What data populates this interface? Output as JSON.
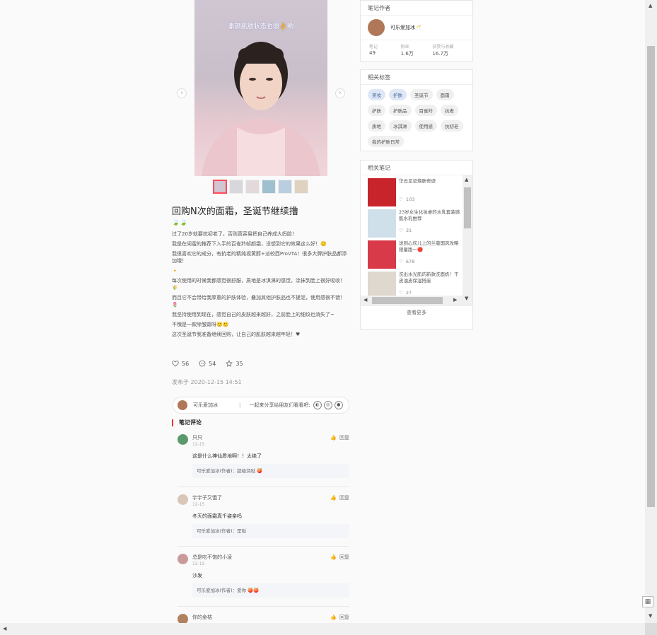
{
  "carousel": {
    "caption": "素颜肌肤状态也很👌哟",
    "prev": "‹",
    "next": "›",
    "thumb_count": 6
  },
  "post": {
    "title": "回购N次的面霜，圣诞节继续撸",
    "emoji_line": "🍃🍃",
    "paragraphs": [
      "过了20岁就要抗初老了，否则真容易把自己养成大妈脸！",
      "我是在闺蜜的推荐下入手的百雀羚帧颜霜，没想到它的效果这么好！🙂",
      "我很喜欢它的成分，有抗老的精纯视黄醇+派较西ProVTA！很多大牌护肤品都添加哦！",
      "🔸",
      "每次使用的时候我都感觉很舒服，质地是冰淇淋的感觉，涂抹到脸上很好吸收！🌾",
      "而且它不会带给我厚重的护肤体验，叠加其他护肤品也不搓泥，使用感很不错！🌷",
      "我坚持使用到现在，感觉自己的皮肤越来越好，之前脸上的细纹也消失了~",
      "不愧是一款除皱霜呀🙂🙂",
      "这次圣诞节我准备继续回购，让自己的肌肤越来越年轻！♥"
    ],
    "likes": "56",
    "comments_count": "54",
    "collects": "35",
    "published": "发布于 2020-12-15 14:51"
  },
  "share": {
    "author": "可乐爱加冰",
    "prompt": "一起来分享给朋友们看看吧:",
    "icons": [
      "wechat-icon",
      "moments-icon",
      "weibo-icon"
    ]
  },
  "comments": {
    "heading": "笔记评论",
    "reply_label": "回复",
    "items": [
      {
        "name": "只只",
        "date": "12-15",
        "text": "这是什么神仙质地啊！！太绝了",
        "reply": "可乐爱加冰(作者)：超级润哒 🍑"
      },
      {
        "name": "宇宇子又饿了",
        "date": "12-15",
        "text": "冬天的面霜真千姿亲吗",
        "reply": "可乐爱加冰(作者)：是哒"
      },
      {
        "name": "总是吃不饱的小凌",
        "date": "12-15",
        "text": "沙发",
        "reply": "可乐爱加冰(作者)：爱你 🍑🍑"
      },
      {
        "name": "你的金桔",
        "date": "",
        "text": "",
        "reply": ""
      }
    ]
  },
  "author_card": {
    "heading": "笔记作者",
    "name": "可乐爱加冰🥂",
    "stats": [
      {
        "label": "笔记",
        "value": "49"
      },
      {
        "label": "粉丝",
        "value": "1.6万"
      },
      {
        "label": "获赞与收藏",
        "value": "16.7万"
      }
    ]
  },
  "tags_card": {
    "heading": "相关标签",
    "tags": [
      {
        "label": "美妆",
        "selected": true
      },
      {
        "label": "护肤",
        "selected": true
      },
      {
        "label": "圣诞节",
        "selected": false
      },
      {
        "label": "面霜",
        "selected": false
      },
      {
        "label": "护肤",
        "selected": false
      },
      {
        "label": "护肤品",
        "selected": false
      },
      {
        "label": "百雀羚",
        "selected": false
      },
      {
        "label": "抗老",
        "selected": false
      },
      {
        "label": "质地",
        "selected": false
      },
      {
        "label": "冰淇淋",
        "selected": false
      },
      {
        "label": "使用感",
        "selected": false
      },
      {
        "label": "抗初老",
        "selected": false
      },
      {
        "label": "我的护肤日常",
        "selected": false
      }
    ]
  },
  "related_card": {
    "heading": "相关笔记",
    "notes": [
      {
        "title": "华云见证焕肤奇迹",
        "likes": "103",
        "color": "#c8242c"
      },
      {
        "title": "23岁女生化妆桌的水乳套装感肌水乳推荐",
        "likes": "31",
        "color": "#cfe0ea"
      },
      {
        "title": "送到心坎儿上的兰蔻国风攻略限量版～🔴",
        "likes": "678",
        "color": "#d83a4a"
      },
      {
        "title": "洗出水光肌的新款洗面奶！干皮油皮保湿搭座",
        "likes": "27",
        "color": "#ded8cf"
      }
    ],
    "see_more": "查看更多"
  }
}
